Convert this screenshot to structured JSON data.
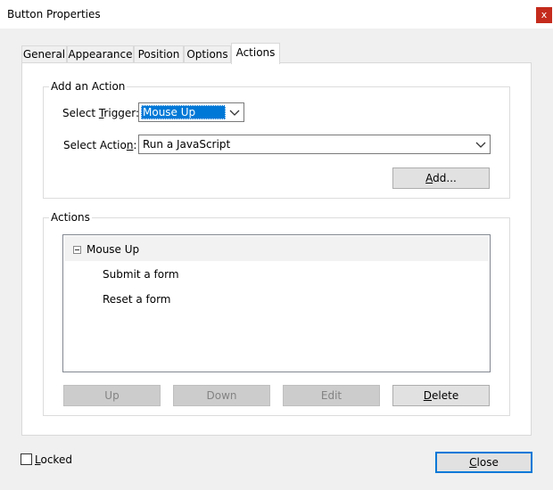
{
  "window": {
    "title": "Button Properties",
    "close_glyph": "x"
  },
  "tabs": [
    {
      "label": "General",
      "active": false
    },
    {
      "label": "Appearance",
      "active": false
    },
    {
      "label": "Position",
      "active": false
    },
    {
      "label": "Options",
      "active": false
    },
    {
      "label": "Actions",
      "active": true
    }
  ],
  "add_action": {
    "group_label": "Add an Action",
    "trigger_label_prefix": "Select ",
    "trigger_label_underlined": "T",
    "trigger_label_suffix": "rigger:",
    "trigger_value": "Mouse Up",
    "action_label_prefix": "Select Actio",
    "action_label_underlined": "n",
    "action_label_suffix": ":",
    "action_value": "Run a JavaScript",
    "add_button_underlined": "A",
    "add_button_rest": "dd..."
  },
  "actions": {
    "group_label": "Actions",
    "tree": {
      "trigger": "Mouse Up",
      "items": [
        "Submit a form",
        "Reset a form"
      ]
    },
    "buttons": {
      "up": "Up",
      "down": "Down",
      "edit": "Edit",
      "delete_underlined": "D",
      "delete_rest": "elete"
    }
  },
  "footer": {
    "locked_underlined": "L",
    "locked_rest": "ocked",
    "locked_checked": false,
    "close_underlined": "C",
    "close_rest": "lose"
  },
  "colors": {
    "selection": "#0078d7",
    "window_close": "#c42b1c",
    "dialog_bg": "#f0f0f0"
  }
}
